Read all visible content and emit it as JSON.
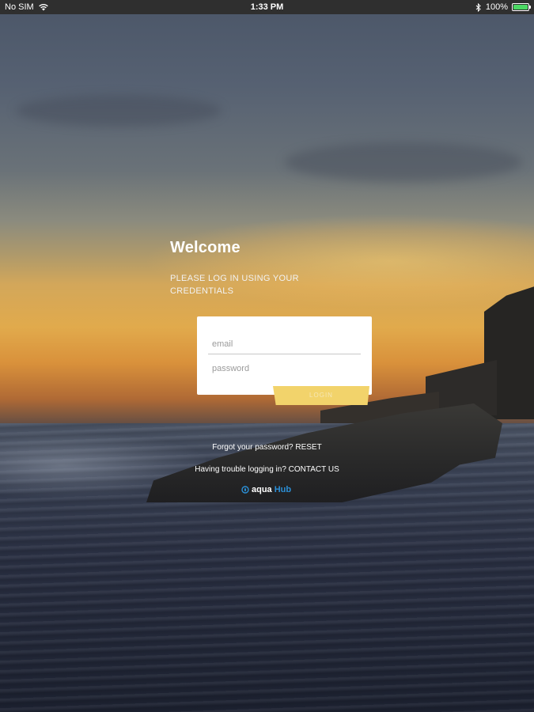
{
  "status_bar": {
    "carrier": "No SIM",
    "time": "1:33 PM",
    "battery": "100%",
    "icons": [
      "wifi-icon",
      "bluetooth-icon",
      "battery-icon"
    ]
  },
  "login": {
    "title": "Welcome",
    "instructions": "PLEASE LOG IN USING YOUR CREDENTIALS",
    "email_placeholder": "email",
    "password_placeholder": "password",
    "login_button": "LOGIN"
  },
  "links": {
    "forgot_text": "Forgot your password?",
    "forgot_action": "RESET",
    "trouble_text": "Having trouble logging in?",
    "trouble_action": "CONTACT US"
  },
  "brand": {
    "part1": "aqua",
    "part2": "Hub",
    "hub_color": "#2b8fd6"
  },
  "colors": {
    "login_button": "#f2d36b",
    "battery_fill": "#4cd964"
  }
}
